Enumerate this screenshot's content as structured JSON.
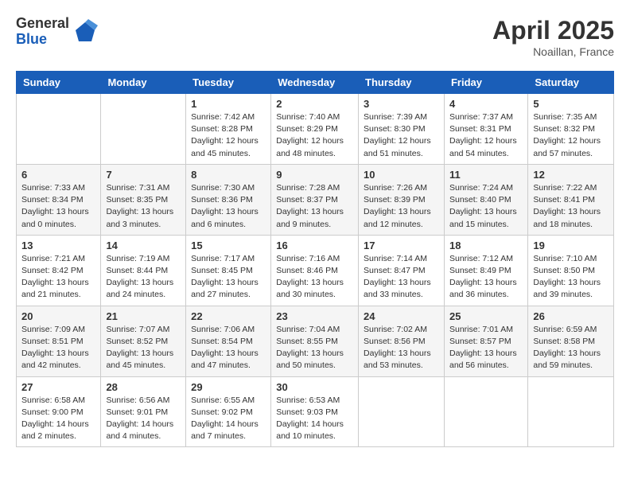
{
  "logo": {
    "general": "General",
    "blue": "Blue"
  },
  "header": {
    "month": "April 2025",
    "location": "Noaillan, France"
  },
  "weekdays": [
    "Sunday",
    "Monday",
    "Tuesday",
    "Wednesday",
    "Thursday",
    "Friday",
    "Saturday"
  ],
  "weeks": [
    [
      {
        "day": "",
        "info": ""
      },
      {
        "day": "",
        "info": ""
      },
      {
        "day": "1",
        "info": "Sunrise: 7:42 AM\nSunset: 8:28 PM\nDaylight: 12 hours and 45 minutes."
      },
      {
        "day": "2",
        "info": "Sunrise: 7:40 AM\nSunset: 8:29 PM\nDaylight: 12 hours and 48 minutes."
      },
      {
        "day": "3",
        "info": "Sunrise: 7:39 AM\nSunset: 8:30 PM\nDaylight: 12 hours and 51 minutes."
      },
      {
        "day": "4",
        "info": "Sunrise: 7:37 AM\nSunset: 8:31 PM\nDaylight: 12 hours and 54 minutes."
      },
      {
        "day": "5",
        "info": "Sunrise: 7:35 AM\nSunset: 8:32 PM\nDaylight: 12 hours and 57 minutes."
      }
    ],
    [
      {
        "day": "6",
        "info": "Sunrise: 7:33 AM\nSunset: 8:34 PM\nDaylight: 13 hours and 0 minutes."
      },
      {
        "day": "7",
        "info": "Sunrise: 7:31 AM\nSunset: 8:35 PM\nDaylight: 13 hours and 3 minutes."
      },
      {
        "day": "8",
        "info": "Sunrise: 7:30 AM\nSunset: 8:36 PM\nDaylight: 13 hours and 6 minutes."
      },
      {
        "day": "9",
        "info": "Sunrise: 7:28 AM\nSunset: 8:37 PM\nDaylight: 13 hours and 9 minutes."
      },
      {
        "day": "10",
        "info": "Sunrise: 7:26 AM\nSunset: 8:39 PM\nDaylight: 13 hours and 12 minutes."
      },
      {
        "day": "11",
        "info": "Sunrise: 7:24 AM\nSunset: 8:40 PM\nDaylight: 13 hours and 15 minutes."
      },
      {
        "day": "12",
        "info": "Sunrise: 7:22 AM\nSunset: 8:41 PM\nDaylight: 13 hours and 18 minutes."
      }
    ],
    [
      {
        "day": "13",
        "info": "Sunrise: 7:21 AM\nSunset: 8:42 PM\nDaylight: 13 hours and 21 minutes."
      },
      {
        "day": "14",
        "info": "Sunrise: 7:19 AM\nSunset: 8:44 PM\nDaylight: 13 hours and 24 minutes."
      },
      {
        "day": "15",
        "info": "Sunrise: 7:17 AM\nSunset: 8:45 PM\nDaylight: 13 hours and 27 minutes."
      },
      {
        "day": "16",
        "info": "Sunrise: 7:16 AM\nSunset: 8:46 PM\nDaylight: 13 hours and 30 minutes."
      },
      {
        "day": "17",
        "info": "Sunrise: 7:14 AM\nSunset: 8:47 PM\nDaylight: 13 hours and 33 minutes."
      },
      {
        "day": "18",
        "info": "Sunrise: 7:12 AM\nSunset: 8:49 PM\nDaylight: 13 hours and 36 minutes."
      },
      {
        "day": "19",
        "info": "Sunrise: 7:10 AM\nSunset: 8:50 PM\nDaylight: 13 hours and 39 minutes."
      }
    ],
    [
      {
        "day": "20",
        "info": "Sunrise: 7:09 AM\nSunset: 8:51 PM\nDaylight: 13 hours and 42 minutes."
      },
      {
        "day": "21",
        "info": "Sunrise: 7:07 AM\nSunset: 8:52 PM\nDaylight: 13 hours and 45 minutes."
      },
      {
        "day": "22",
        "info": "Sunrise: 7:06 AM\nSunset: 8:54 PM\nDaylight: 13 hours and 47 minutes."
      },
      {
        "day": "23",
        "info": "Sunrise: 7:04 AM\nSunset: 8:55 PM\nDaylight: 13 hours and 50 minutes."
      },
      {
        "day": "24",
        "info": "Sunrise: 7:02 AM\nSunset: 8:56 PM\nDaylight: 13 hours and 53 minutes."
      },
      {
        "day": "25",
        "info": "Sunrise: 7:01 AM\nSunset: 8:57 PM\nDaylight: 13 hours and 56 minutes."
      },
      {
        "day": "26",
        "info": "Sunrise: 6:59 AM\nSunset: 8:58 PM\nDaylight: 13 hours and 59 minutes."
      }
    ],
    [
      {
        "day": "27",
        "info": "Sunrise: 6:58 AM\nSunset: 9:00 PM\nDaylight: 14 hours and 2 minutes."
      },
      {
        "day": "28",
        "info": "Sunrise: 6:56 AM\nSunset: 9:01 PM\nDaylight: 14 hours and 4 minutes."
      },
      {
        "day": "29",
        "info": "Sunrise: 6:55 AM\nSunset: 9:02 PM\nDaylight: 14 hours and 7 minutes."
      },
      {
        "day": "30",
        "info": "Sunrise: 6:53 AM\nSunset: 9:03 PM\nDaylight: 14 hours and 10 minutes."
      },
      {
        "day": "",
        "info": ""
      },
      {
        "day": "",
        "info": ""
      },
      {
        "day": "",
        "info": ""
      }
    ]
  ]
}
